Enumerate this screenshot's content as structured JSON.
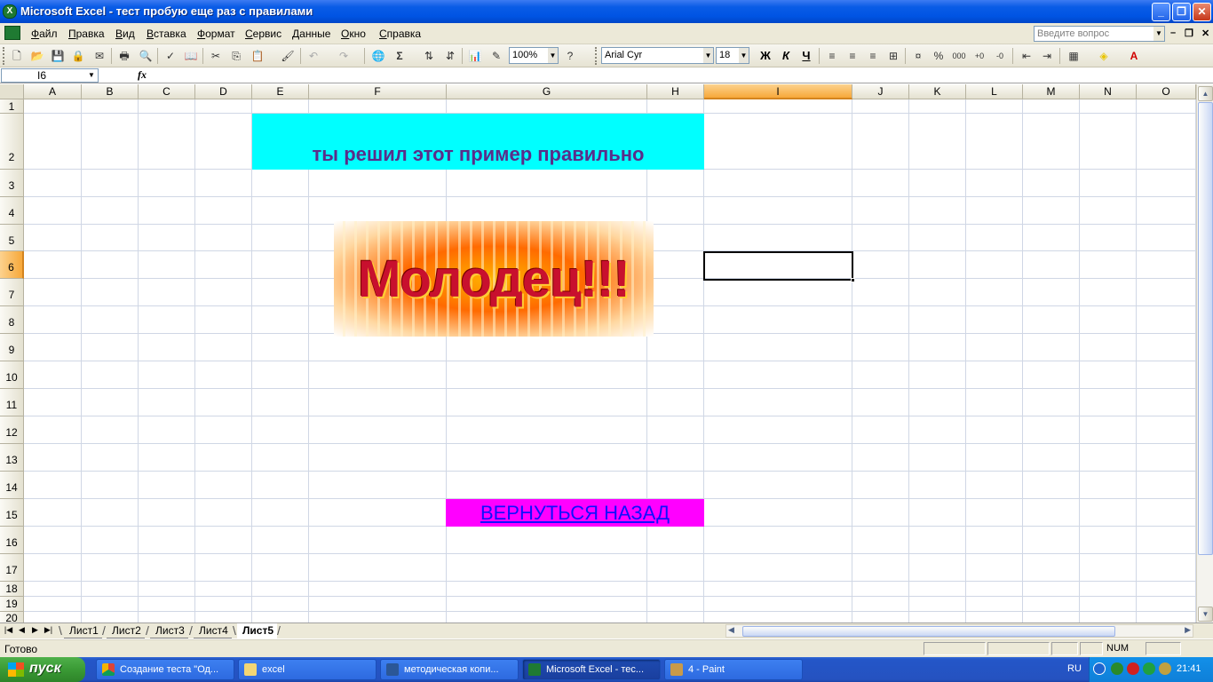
{
  "window": {
    "title": "Microsoft Excel - тест пробую еще раз с правилами"
  },
  "menu": {
    "items": [
      "Файл",
      "Правка",
      "Вид",
      "Вставка",
      "Формат",
      "Сервис",
      "Данные",
      "Окно",
      "Справка"
    ],
    "ask_placeholder": "Введите вопрос"
  },
  "toolbar": {
    "zoom": "100%",
    "font_name": "Arial Cyr",
    "font_size": "18",
    "bold_label": "Ж",
    "italic_label": "К",
    "underline_label": "Ч"
  },
  "formula_bar": {
    "name_box": "I6",
    "fx_label": "fx",
    "formula": ""
  },
  "grid": {
    "columns": [
      "A",
      "B",
      "C",
      "D",
      "E",
      "F",
      "G",
      "H",
      "I",
      "J",
      "K",
      "L",
      "M",
      "N",
      "O"
    ],
    "rows": [
      "1",
      "2",
      "3",
      "4",
      "5",
      "6",
      "7",
      "8",
      "9",
      "10",
      "11",
      "12",
      "13",
      "14",
      "15",
      "16",
      "17",
      "18",
      "19",
      "20"
    ],
    "selected_column": "I",
    "selected_row": "6",
    "cyan_text": "ты решил этот пример правильно",
    "picture_text": "Молодец!!!",
    "link_text": "ВЕРНУТЬСЯ НАЗАД",
    "colors": {
      "cyan_fill": "#00ffff",
      "magenta_fill": "#ff00ff",
      "link_color": "#1010ff",
      "cyan_text_color": "#5a2d8a"
    }
  },
  "sheets": {
    "tabs": [
      "Лист1",
      "Лист2",
      "Лист3",
      "Лист4",
      "Лист5"
    ],
    "active": "Лист5"
  },
  "status": {
    "text": "Готово",
    "num": "NUM"
  },
  "taskbar": {
    "start_label": "пуск",
    "tasks": [
      "Создание теста \"Од...",
      "excel",
      "методическая копи...",
      "Microsoft Excel - тес...",
      "4 - Paint"
    ],
    "language": "RU",
    "clock": "21:41"
  }
}
